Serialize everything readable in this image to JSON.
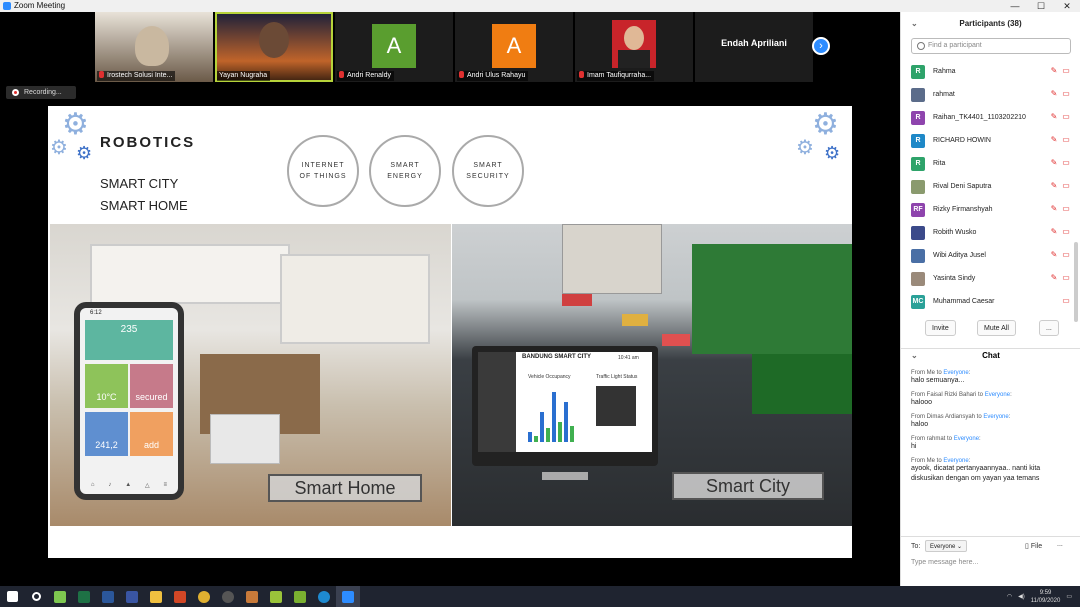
{
  "window": {
    "title": "Zoom Meeting",
    "controls": [
      "—",
      "☐",
      "✕"
    ]
  },
  "gallery": {
    "tiles": [
      {
        "name": "Irostech Solusi Inte...",
        "type": "video"
      },
      {
        "name": "Yayan Nugraha",
        "type": "video",
        "active": true
      },
      {
        "name": "Andri Renaldy",
        "initial": "A",
        "color": "#5a9e2f"
      },
      {
        "name": "Andri Ulus Rahayu",
        "initial": "A",
        "color": "#f07d12"
      },
      {
        "name": "Imam Taufiqurraha...",
        "type": "video"
      },
      {
        "name": "Endah Apriliani",
        "type": "name_only"
      }
    ]
  },
  "recording": {
    "label": "Recording..."
  },
  "slide": {
    "title": "ROBOTICS",
    "subtitle1": "SMART CITY",
    "subtitle2": "SMART HOME",
    "circles": [
      {
        "label": "INTERNET OF THINGS"
      },
      {
        "label": "SMART ENERGY"
      },
      {
        "label": "SMART SECURITY"
      }
    ],
    "home_caption": "Smart Home",
    "city_caption": "Smart City",
    "phone": {
      "time": "6:12",
      "value": "235",
      "temp": "10°C",
      "secured": "secured",
      "water": "241,2",
      "add": "add"
    },
    "monitor": {
      "title": "BANDUNG SMART CITY",
      "chart_title": "Vehicle Occupancy",
      "traffic": "Traffic Light Status",
      "clock": "10:41 am"
    }
  },
  "participants": {
    "header": "Participants (38)",
    "search_placeholder": "Find a participant",
    "list": [
      {
        "name": "Rahma",
        "initial": "R",
        "color": "#2ea36a"
      },
      {
        "name": "rahmat",
        "initial": "",
        "color": "#5b6c8a",
        "photo": true
      },
      {
        "name": "Raihan_TK4401_1103202210",
        "initial": "R",
        "color": "#8e44ad"
      },
      {
        "name": "RICHARD HOWIN",
        "initial": "R",
        "color": "#1e88c7"
      },
      {
        "name": "Rita",
        "initial": "R",
        "color": "#2ea36a"
      },
      {
        "name": "Rival Deni Saputra",
        "initial": "",
        "color": "#8a9a6e",
        "photo": true
      },
      {
        "name": "Rizky Firmanshyah",
        "initial": "RF",
        "color": "#8e44ad"
      },
      {
        "name": "Robith Wusko",
        "initial": "",
        "color": "#3b4a8a",
        "photo": true
      },
      {
        "name": "Wibi Aditya Jusel",
        "initial": "",
        "color": "#4a6fa5",
        "photo": true
      },
      {
        "name": "Yasinta Sindy",
        "initial": "",
        "color": "#9a8a7a",
        "photo": true
      },
      {
        "name": "Muhammad Caesar",
        "initial": "MC",
        "color": "#2aa198"
      }
    ],
    "invite_label": "Invite",
    "mute_all_label": "Mute All",
    "more_label": "..."
  },
  "chat": {
    "header": "Chat",
    "messages": [
      {
        "from": "From Me to",
        "to": "Everyone",
        "text": "halo semuanya..."
      },
      {
        "from": "From Faisal Rizki Bahari to",
        "to": "Everyone",
        "text": "halooo"
      },
      {
        "from": "From Dimas Ardiansyah to",
        "to": "Everyone",
        "text": "haloo"
      },
      {
        "from": "From rahmat to",
        "to": "Everyone",
        "text": "hi"
      },
      {
        "from": "From Me to",
        "to": "Everyone",
        "text": "ayook, dicatat pertanyaannyaa.. nanti kita diskusikan dengan om yayan yaa temans"
      }
    ],
    "to_label": "To:",
    "recipient": "Everyone",
    "file_label": "File",
    "more_label": "...",
    "input_placeholder": "Type message here..."
  },
  "taskbar": {
    "time": "9:59",
    "date": "11/09/2020"
  }
}
